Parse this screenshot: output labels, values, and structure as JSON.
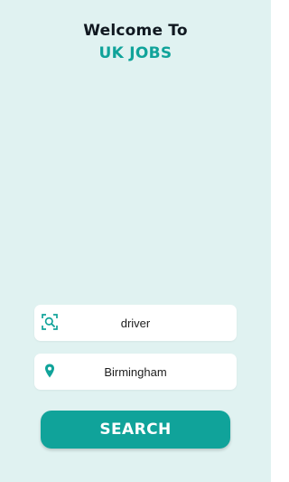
{
  "header": {
    "welcome": "Welcome To",
    "brand": "UK JOBS"
  },
  "keyword_field": {
    "icon": "search-scan-icon",
    "value": "driver"
  },
  "location_field": {
    "icon": "location-pin-icon",
    "value": "Birmingham"
  },
  "search_button": {
    "label": "SEARCH"
  },
  "colors": {
    "background": "#e0f2f1",
    "accent": "#10a39a",
    "text_dark": "#101820",
    "field_background": "#ffffff"
  }
}
